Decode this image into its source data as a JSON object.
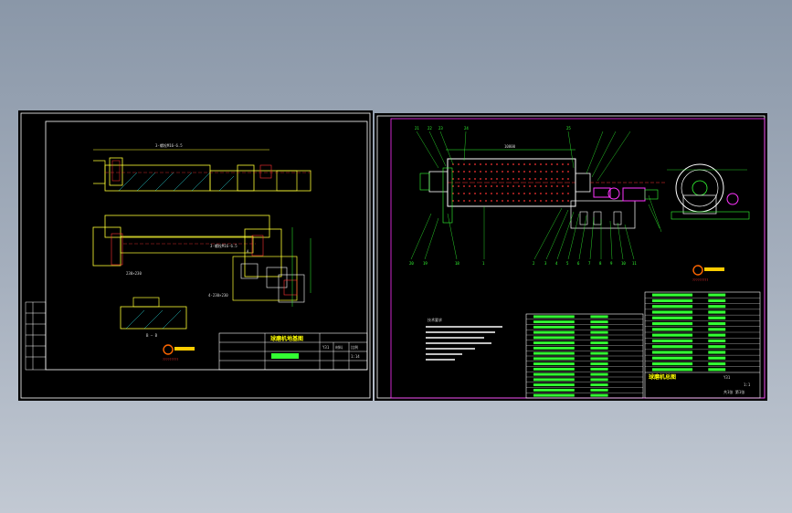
{
  "left_sheet": {
    "dim_top": "3-螺栓M16-6.5",
    "dim_mid": "3-螺栓M16-6.5",
    "dim_small_1": "230×230",
    "dim_small_2": "4-230×230",
    "section_label": "B — B",
    "view_label": "A",
    "title_block": {
      "title": "球磨机地基图",
      "col1": "Y31",
      "col2": "材料",
      "col3": "比例",
      "col4": "1:14",
      "logo_caption": "?????????"
    }
  },
  "right_sheet": {
    "dim_length": "10800",
    "notes_title": "技术要求",
    "logo_caption": "?????????",
    "title_block": {
      "title": "球磨机总图",
      "col1": "Y31",
      "col4": "1:1",
      "sheet": "共1张 第1张"
    },
    "balloons_bottom": [
      "20",
      "19",
      "18",
      "1",
      "2",
      "3",
      "4",
      "5",
      "6",
      "7",
      "8",
      "9",
      "10",
      "11",
      "12",
      "13",
      "14",
      "15",
      "16",
      "17"
    ],
    "balloons_top": [
      "21",
      "22",
      "23",
      "24",
      "25"
    ]
  },
  "colors": {
    "frame": "#ffffff",
    "line_green": "#33ff33",
    "line_yellow": "#ffff33",
    "line_magenta": "#ff33ff",
    "line_red": "#ff3333",
    "hatch_cyan": "#33ffff"
  }
}
